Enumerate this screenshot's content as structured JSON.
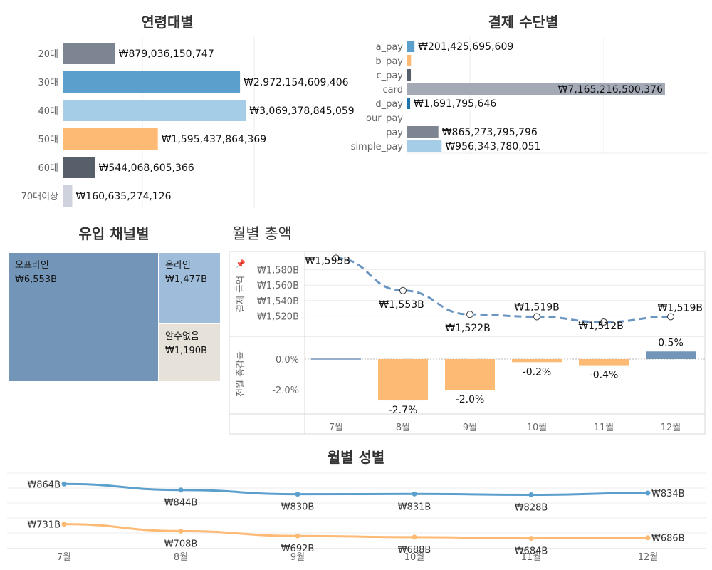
{
  "colors": {
    "blue": "#5b9fcd",
    "light_blue": "#a6cde8",
    "orange": "#fdba74",
    "gray": "#7d8593",
    "dark_gray": "#575f6b",
    "light_gray": "#cdd2dc",
    "deep_blue": "#1f73ad",
    "steel": "#7395b8",
    "steel_light": "#9fbdda",
    "beige": "#e6e2da",
    "slate": "#a3aab6"
  },
  "chart_data": [
    {
      "id": "age",
      "type": "bar",
      "orientation": "horizontal",
      "title": "연령대별",
      "categories": [
        "20대",
        "30대",
        "40대",
        "50대",
        "60대",
        "70대이상"
      ],
      "values": [
        879036150747,
        2972154609406,
        3069378845059,
        1595437864369,
        544068605366,
        160635274126
      ],
      "labels": [
        "₩879,036,150,747",
        "₩2,972,154,609,406",
        "₩3,069,378,845,059",
        "₩1,595,437,864,369",
        "₩544,068,605,366",
        "₩160,635,274,126"
      ],
      "colors": [
        "#7d8593",
        "#5b9fcd",
        "#a6cde8",
        "#fdba74",
        "#575f6b",
        "#cdd2dc"
      ],
      "xlim": [
        0,
        4200000000000
      ]
    },
    {
      "id": "payment",
      "type": "bar",
      "orientation": "horizontal",
      "title": "결제 수단별",
      "categories": [
        "a_pay",
        "b_pay",
        "c_pay",
        "card",
        "d_pay",
        "our_pay",
        "pay",
        "simple_pay"
      ],
      "values": [
        201425695609,
        105000000000,
        100000000000,
        7165216500376,
        1691795646,
        0,
        865273795796,
        956343780051
      ],
      "labels": [
        "₩201,425,695,609",
        "",
        "",
        "₩7,165,216,500,376",
        "₩1,691,795,646",
        "",
        "₩865,273,795,796",
        "₩956,343,780,051"
      ],
      "colors": [
        "#5b9fcd",
        "#fdba74",
        "#575f6b",
        "#a3aab6",
        "#1f73ad",
        "#cdd2dc",
        "#7d8593",
        "#a6cde8"
      ]
    },
    {
      "id": "channel",
      "type": "treemap",
      "title": "유입 채널별",
      "items": [
        {
          "name": "오프라인",
          "value": 6553,
          "label": "₩6,553B",
          "color": "#7395b8"
        },
        {
          "name": "온라인",
          "value": 1477,
          "label": "₩1,477B",
          "color": "#9fbdda"
        },
        {
          "name": "알수없음",
          "value": 1190,
          "label": "₩1,190B",
          "color": "#e6e2da"
        }
      ]
    },
    {
      "id": "monthly_total",
      "type": "line",
      "title": "월별 총액",
      "categories": [
        "7월",
        "8월",
        "9월",
        "10월",
        "11월",
        "12월"
      ],
      "top": {
        "ylabel": "결제 금액",
        "values": [
          1595,
          1553,
          1522,
          1519,
          1512,
          1519
        ],
        "labels": [
          "₩1,595B",
          "₩1,553B",
          "₩1,522B",
          "₩1,519B",
          "₩1,512B",
          "₩1,519B"
        ],
        "yticks": [
          "₩1,520B",
          "₩1,540B",
          "₩1,560B",
          "₩1,580B"
        ],
        "ytick_values": [
          1520,
          1540,
          1560,
          1580
        ],
        "ylim": [
          1500,
          1600
        ],
        "color": "#6a95c0"
      },
      "bottom": {
        "type": "bar",
        "ylabel": "전월 증감률",
        "values": [
          0.0,
          -2.7,
          -2.0,
          -0.2,
          -0.4,
          0.5
        ],
        "labels": [
          "",
          "-2.7%",
          "-2.0%",
          "-0.2%",
          "-0.4%",
          "0.5%"
        ],
        "yticks": [
          "0.0%",
          "-2.0%"
        ],
        "ytick_values": [
          0,
          -2
        ],
        "ylim": [
          -3.5,
          1.0
        ],
        "neg_color": "#fdba74",
        "pos_color": "#7395b8"
      }
    },
    {
      "id": "monthly_gender",
      "type": "line",
      "title": "월별 성별",
      "categories": [
        "7월",
        "8월",
        "9월",
        "10월",
        "11월",
        "12월"
      ],
      "ylim": [
        650,
        900
      ],
      "series": [
        {
          "values": [
            864,
            844,
            830,
            831,
            828,
            834
          ],
          "labels": [
            "₩864B",
            "₩844B",
            "₩830B",
            "₩831B",
            "₩828B",
            "₩834B"
          ],
          "color": "#5b9fcd"
        },
        {
          "values": [
            731,
            708,
            692,
            688,
            684,
            686
          ],
          "labels": [
            "₩731B",
            "₩708B",
            "₩692B",
            "₩688B",
            "₩684B",
            "₩686B"
          ],
          "color": "#fdba74"
        }
      ]
    }
  ]
}
